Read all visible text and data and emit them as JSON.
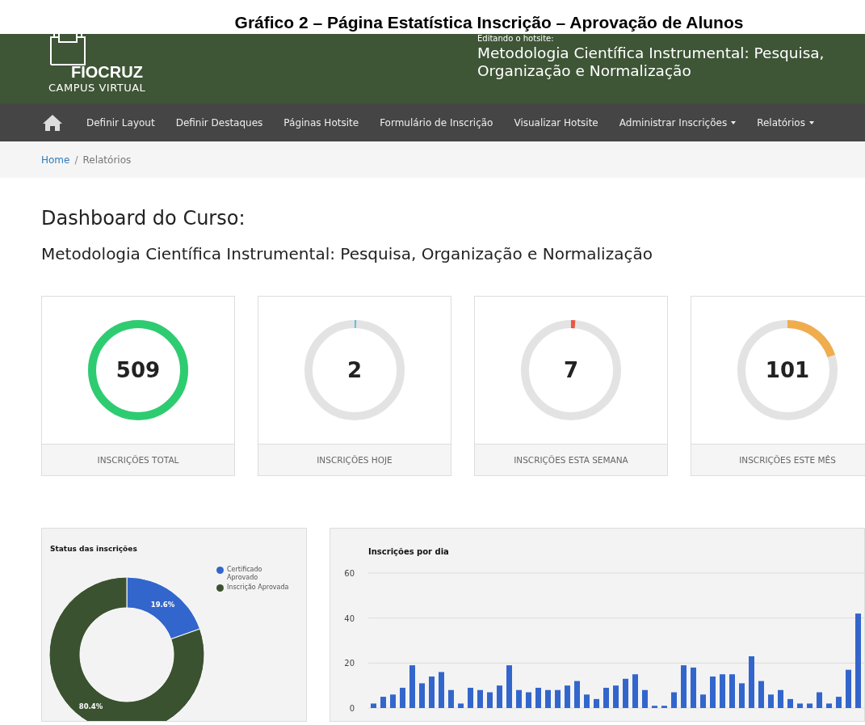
{
  "caption": "Gráfico 2 – Página Estatística Inscrição – Aprovação de Alunos",
  "header": {
    "logo_title": "FIOCRUZ",
    "logo_subtitle": "CAMPUS VIRTUAL",
    "editing_label": "Editando o hotsite:",
    "hotsite_title": "Metodologia Científica Instrumental: Pesquisa, Organização e Normalização"
  },
  "nav": [
    {
      "label": "Definir Layout",
      "dropdown": false
    },
    {
      "label": "Definir Destaques",
      "dropdown": false
    },
    {
      "label": "Páginas Hotsite",
      "dropdown": false
    },
    {
      "label": "Formulário de Inscrição",
      "dropdown": false
    },
    {
      "label": "Visualizar Hotsite",
      "dropdown": false
    },
    {
      "label": "Administrar Inscrições",
      "dropdown": true
    },
    {
      "label": "Relatórios",
      "dropdown": true
    }
  ],
  "breadcrumb": [
    "Home",
    "Relatórios"
  ],
  "breadcrumb_separator": "/",
  "page_title": "Dashboard do Curso:",
  "course_title": "Metodologia Científica Instrumental: Pesquisa, Organização e Normalização",
  "stats": [
    {
      "value": "509",
      "label": "INSCRIÇÕES TOTAL",
      "level": 1,
      "color": "#2ecc71"
    },
    {
      "value": "2",
      "label": "INSCRIÇÕES HOJE",
      "level": 0.005,
      "color": "#5bc0de"
    },
    {
      "value": "7",
      "label": "INSCRIÇÕES ESTA SEMANA",
      "level": 0.014,
      "color": "#e9573f"
    },
    {
      "value": "101",
      "label": "INSCRIÇÕES ESTE MÊS",
      "level": 0.2,
      "color": "#f0ad4e"
    }
  ],
  "status_panel": {
    "chart_data": {
      "type": "donut",
      "title": "Status das inscrições",
      "categories": [
        "Certificado Aprovado",
        "Inscrição Aprovada"
      ],
      "values": [
        19.6,
        80.4
      ],
      "value_labels": [
        "19.6%",
        "80.4%"
      ]
    }
  },
  "daily_panel": {
    "chart_data": {
      "type": "bar",
      "title": "Inscrições por dia",
      "ylim": [
        0,
        60
      ],
      "yticks": [
        0,
        20,
        40,
        60
      ],
      "values": [
        2,
        5,
        6,
        9,
        19,
        11,
        14,
        16,
        8,
        2,
        9,
        8,
        7,
        10,
        19,
        8,
        7,
        9,
        8,
        8,
        10,
        12,
        6,
        4,
        9,
        10,
        13,
        15,
        8,
        1,
        1,
        7,
        19,
        18,
        6,
        14,
        15,
        15,
        11,
        23,
        12,
        6,
        8,
        4,
        2,
        2,
        7,
        2,
        5,
        17,
        42
      ]
    }
  }
}
